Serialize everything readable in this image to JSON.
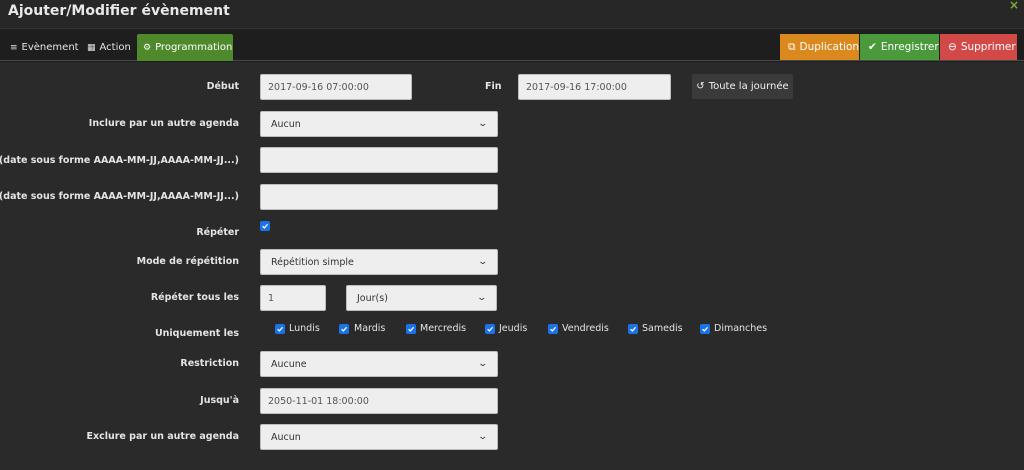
{
  "window": {
    "title": "Ajouter/Modifier évènement",
    "close": "×"
  },
  "tabs": [
    {
      "label": "Evènement",
      "icon": "≡"
    },
    {
      "label": "Action",
      "icon": "▦"
    },
    {
      "label": "Programmation",
      "icon": "⚙"
    }
  ],
  "toolbar": {
    "duplicate_label": "Duplication",
    "save_label": "Enregistrer",
    "delete_label": "Supprimer"
  },
  "form": {
    "start": {
      "label": "Début",
      "value": "2017-09-16 07:00:00"
    },
    "end": {
      "label": "Fin",
      "value": "2017-09-16 17:00:00"
    },
    "allday_label": "Toute la journée",
    "include_agenda": {
      "label": "Inclure par un autre agenda",
      "value": "Aucun"
    },
    "include_dates": {
      "label": "Inclure (date sous forme AAAA-MM-JJ,AAAA-MM-JJ...)",
      "value": ""
    },
    "exclude_dates": {
      "label": "Exclure (date sous forme AAAA-MM-JJ,AAAA-MM-JJ...)",
      "value": ""
    },
    "repeat": {
      "label": "Répéter",
      "checked": true
    },
    "repeat_mode": {
      "label": "Mode de répétition",
      "value": "Répétition simple"
    },
    "repeat_every": {
      "label": "Répéter tous les",
      "value": "1",
      "unit": "Jour(s)"
    },
    "only_days": {
      "label": "Uniquement les",
      "days": [
        "Lundis",
        "Mardis",
        "Mercredis",
        "Jeudis",
        "Vendredis",
        "Samedis",
        "Dimanches"
      ]
    },
    "restriction": {
      "label": "Restriction",
      "value": "Aucune"
    },
    "until": {
      "label": "Jusqu'à",
      "value": "2050-11-01 18:00:00"
    },
    "exclude_agenda": {
      "label": "Exclure par un autre agenda",
      "value": "Aucun"
    }
  },
  "colors": {
    "active_tab": "#4e8a2c",
    "duplicate": "#d9891e",
    "save": "#4a9a3c",
    "delete": "#d24a48",
    "checkbox": "#1a73e8"
  }
}
